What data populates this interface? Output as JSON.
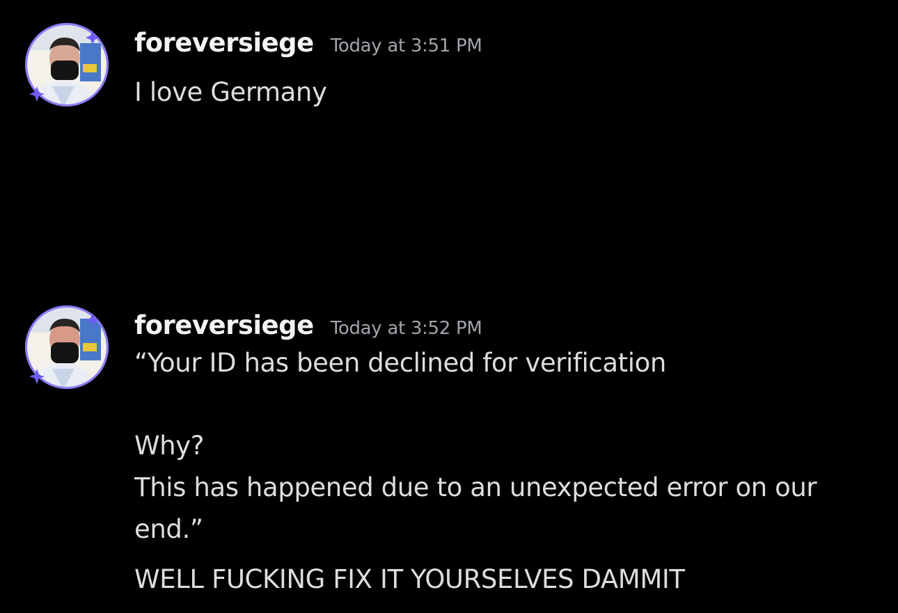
{
  "colors": {
    "background": "#000000",
    "username": "#f2f3f5",
    "timestamp": "#a1a5ac",
    "message_text": "#dbdee1",
    "avatar_ring": "#8b7cf6"
  },
  "messages": [
    {
      "username": "foreversiege",
      "timestamp": "Today at 3:51 PM",
      "avatar_icon": "user-avatar-icon",
      "lines": [
        "I love Germany"
      ]
    },
    {
      "username": "foreversiege",
      "timestamp": "Today at 3:52 PM",
      "avatar_icon": "user-avatar-icon",
      "lines": [
        "“Your ID has been declined for verification",
        "Why?",
        "This has happened due to an unexpected error on our",
        "end.”",
        "WELL FUCKING FIX IT YOURSELVES DAMMIT"
      ]
    }
  ]
}
